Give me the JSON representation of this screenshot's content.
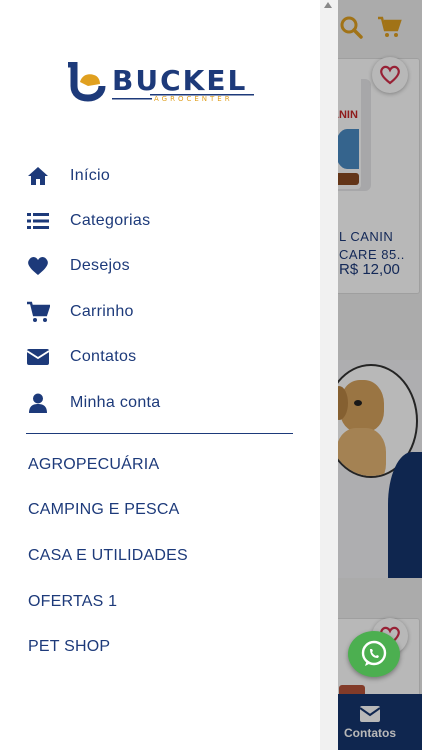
{
  "colors": {
    "brand_blue": "#1d3a7a",
    "accent_orange": "#e0a020",
    "whatsapp_green": "#4caf50",
    "heart_red": "#d32f4a"
  },
  "logo": {
    "brand": "BUCKEL",
    "sub": "AGROCENTER"
  },
  "menu": {
    "items": [
      {
        "icon": "home-icon",
        "label": "Início"
      },
      {
        "icon": "list-icon",
        "label": "Categorias"
      },
      {
        "icon": "heart-icon",
        "label": "Desejos"
      },
      {
        "icon": "cart-icon",
        "label": "Carrinho"
      },
      {
        "icon": "envelope-icon",
        "label": "Contatos"
      },
      {
        "icon": "user-icon",
        "label": "Minha conta"
      }
    ]
  },
  "categories": [
    "AGROPECUÁRIA",
    "CAMPING E PESCA",
    "CASA E UTILIDADES",
    "OFERTAS 1",
    "PET SHOP"
  ],
  "background": {
    "product_name_line1": "L CANIN",
    "product_name_line2": "CARE 85..",
    "product_price": "R$ 12,00",
    "package_label": "ANIN",
    "bottom_nav_label": "Contatos"
  }
}
